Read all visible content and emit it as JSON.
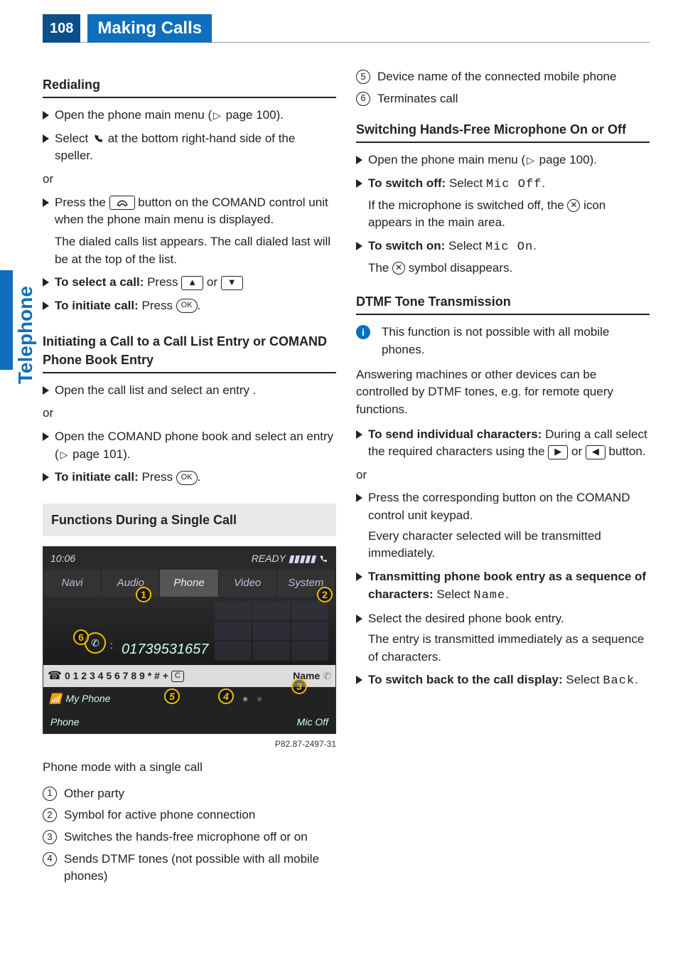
{
  "header": {
    "page_number": "108",
    "title": "Making Calls"
  },
  "side_tab": "Telephone",
  "left": {
    "sec1_title": "Redialing",
    "l1a": "Open the phone main menu (",
    "l1b": " page 100).",
    "l2a": "Select ",
    "l2b": " at the bottom right-hand side of the speller.",
    "or": "or",
    "l3a": "Press the ",
    "l3b": " button on the COMAND control unit when the phone main menu is displayed.",
    "l3c": "The dialed calls list appears. The call dialed last will be at the top of the list.",
    "l4a": "To select a call:",
    "l4b": " Press ",
    "l4c": " or ",
    "l5a": "To initiate call:",
    "l5b": " Press ",
    "ok": "OK",
    "sec2_title": "Initiating a Call to a Call List Entry or COMAND Phone Book Entry",
    "l6": "Open the call list and select an entry .",
    "l7a": "Open the COMAND phone book and select an entry (",
    "l7b": " page 101).",
    "box_title": "Functions During a Single Call",
    "scr": {
      "time": "10:06",
      "ready": "READY ▮▮▮▮▮",
      "tabs": [
        "Navi",
        "Audio",
        "Phone",
        "Video",
        "System"
      ],
      "dialed": "01739531657",
      "keys": "0 1 2 3 4 5 6 7 8 9 * # +",
      "clear": "C",
      "name": "Name",
      "myphone": "My Phone",
      "menu_l": "Phone",
      "menu_r": "Mic Off",
      "ref": "P82.87-2497-31",
      "m1": "1",
      "m2": "2",
      "m3": "3",
      "m4": "4",
      "m5": "5",
      "m6": "6"
    },
    "caption": "Phone mode with a single call",
    "i1": "Other party",
    "i2": "Symbol for active phone connection",
    "i3": "Switches the hands-free microphone off or on",
    "i4": "Sends DTMF tones (not possible with all mobile phones)"
  },
  "right": {
    "i5": "Device name of the connected mobile phone",
    "i6": "Terminates call",
    "sec3_title": "Switching Hands-Free Microphone On or Off",
    "r1a": "Open the phone main menu (",
    "r1b": " page 100).",
    "r2a": "To switch off:",
    "r2b": " Select ",
    "mic_off": "Mic Off",
    "r2c": ".",
    "r2d": "If the microphone is switched off, the ",
    "r2e": " icon appears in the main area.",
    "r3a": "To switch on:",
    "r3b": " Select ",
    "mic_on": "Mic On",
    "r3c": ".",
    "r3d": "The ",
    "r3e": " symbol disappears.",
    "sec4_title": "DTMF Tone Transmission",
    "info": "This function is not possible with all mobile phones.",
    "para": "Answering machines or other devices can be controlled by DTMF tones, e.g. for remote query functions.",
    "r4a": "To send individual characters:",
    "r4b": " During a call select the required characters using the ",
    "r4c": " or ",
    "r4d": " button.",
    "r5a": "Press the corresponding button on the COMAND control unit keypad.",
    "r5b": "Every character selected will be transmitted immediately.",
    "r6a": "Transmitting phone book entry as a sequence of characters:",
    "r6b": " Select ",
    "name": "Name",
    "r6c": ".",
    "r7a": "Select the desired phone book entry.",
    "r7b": "The entry is transmitted immediately as a sequence of characters.",
    "r8a": "To switch back to the call display:",
    "r8b": " Select ",
    "back": "Back",
    "r8c": "."
  }
}
